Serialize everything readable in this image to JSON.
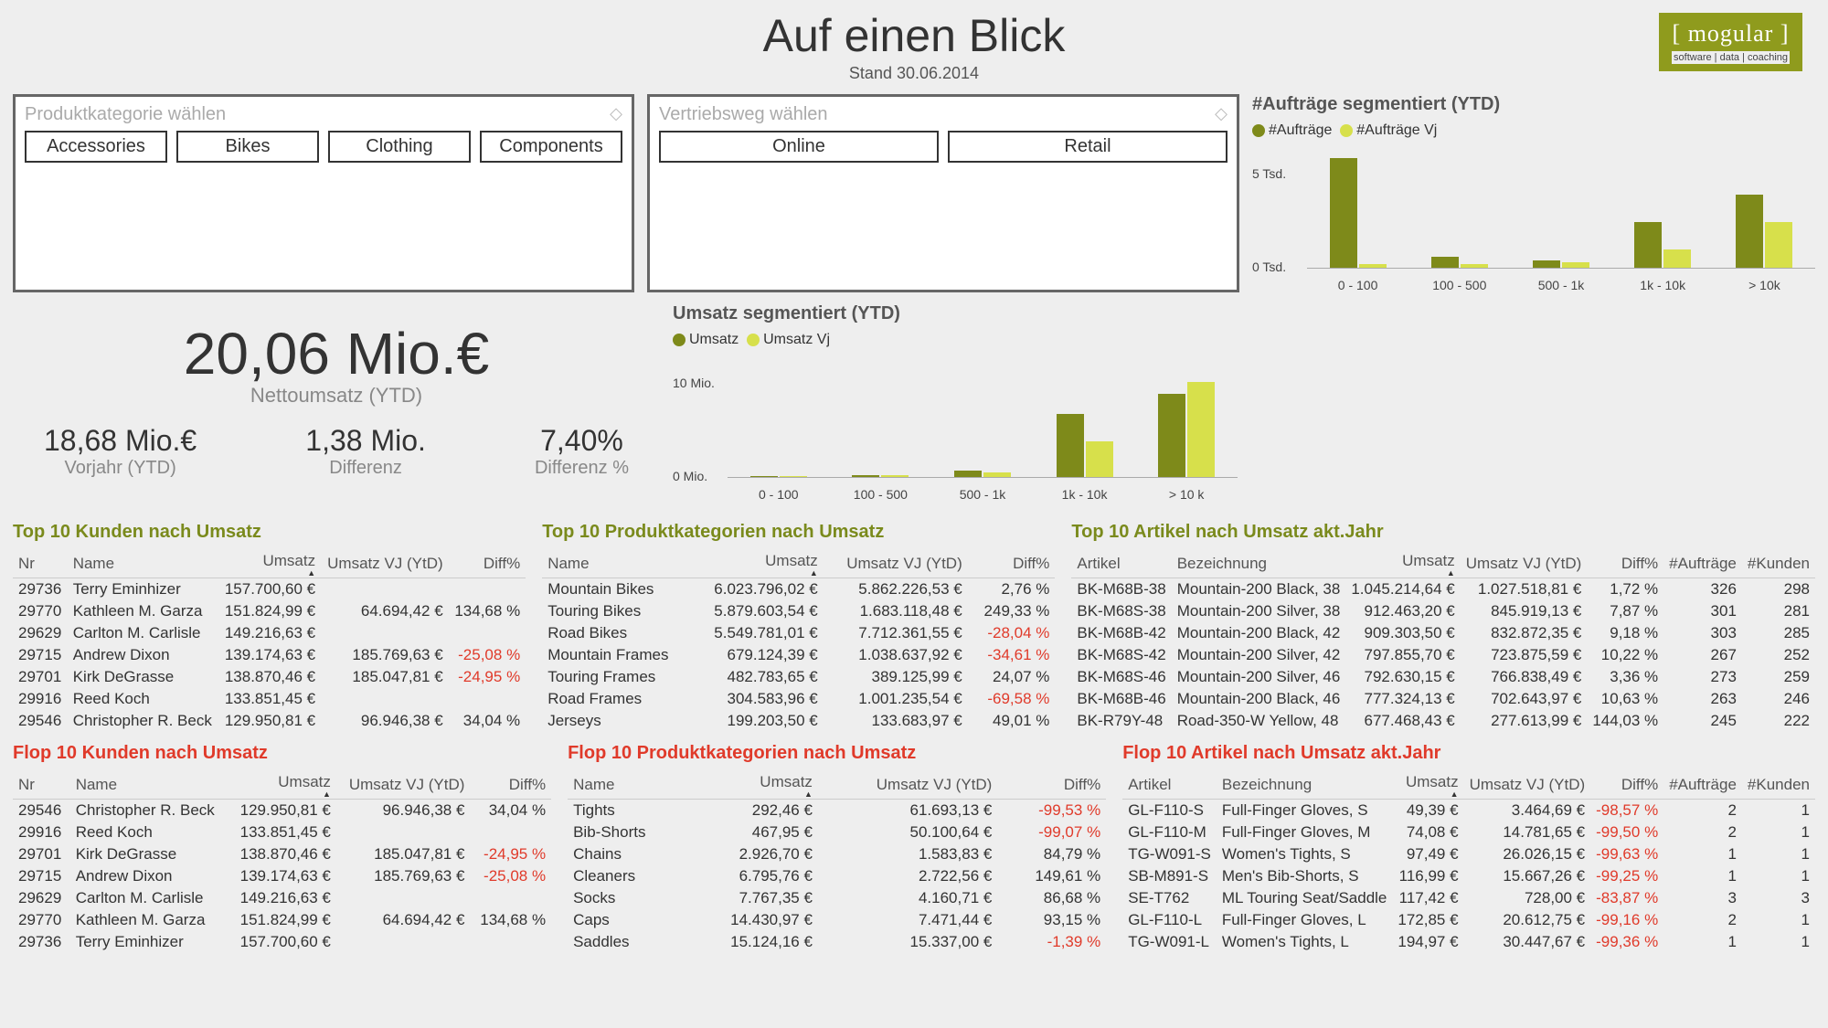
{
  "header": {
    "title": "Auf einen Blick",
    "subtitle": "Stand 30.06.2014"
  },
  "logo": {
    "name": "[ mogular ]",
    "tag": "software | data | coaching"
  },
  "filters": {
    "cat": {
      "label": "Produktkategorie wählen",
      "options": [
        "Accessories",
        "Bikes",
        "Clothing",
        "Components"
      ]
    },
    "channel": {
      "label": "Vertriebsweg wählen",
      "options": [
        "Online",
        "Retail"
      ]
    }
  },
  "kpi": {
    "net": "20,06 Mio.€",
    "netLabel": "Nettoumsatz (YTD)",
    "prev": "18,68 Mio.€",
    "prevLabel": "Vorjahr (YTD)",
    "diff": "1,38 Mio.",
    "diffLabel": "Differenz",
    "diffPct": "7,40%",
    "diffPctLabel": "Differenz %"
  },
  "chart_data": [
    {
      "id": "umsatz",
      "type": "bar",
      "title": "Umsatz segmentiert (YTD)",
      "legend": [
        "Umsatz",
        "Umsatz Vj"
      ],
      "categories": [
        "0 - 100",
        "100 - 500",
        "500 - 1k",
        "1k - 10k",
        "> 10 k"
      ],
      "ylabels": [
        "0 Mio.",
        "10 Mio."
      ],
      "ylim": [
        0,
        15
      ],
      "series": [
        {
          "name": "Umsatz",
          "values": [
            0.1,
            0.2,
            0.8,
            8.0,
            10.5
          ]
        },
        {
          "name": "Umsatz Vj",
          "values": [
            0.1,
            0.2,
            0.6,
            4.5,
            12.0
          ]
        }
      ]
    },
    {
      "id": "auftraege",
      "type": "bar",
      "title": "#Aufträge segmentiert (YTD)",
      "legend": [
        "#Aufträge",
        "#Aufträge Vj"
      ],
      "categories": [
        "0 - 100",
        "100 - 500",
        "500 - 1k",
        "1k - 10k",
        "> 10k"
      ],
      "ylabels": [
        "0 Tsd.",
        "5 Tsd."
      ],
      "ylim": [
        0,
        6.5
      ],
      "series": [
        {
          "name": "#Aufträge",
          "values": [
            6.0,
            0.6,
            0.4,
            2.5,
            4.0
          ]
        },
        {
          "name": "#Aufträge Vj",
          "values": [
            0.2,
            0.2,
            0.3,
            1.0,
            2.5
          ]
        }
      ]
    }
  ],
  "tables": {
    "topKunden": {
      "title": "Top 10 Kunden nach Umsatz",
      "headers": [
        "Nr",
        "Name",
        "Umsatz",
        "Umsatz VJ (YtD)",
        "Diff%"
      ],
      "rows": [
        [
          "29736",
          "Terry Eminhizer",
          "157.700,60 €",
          "",
          ""
        ],
        [
          "29770",
          "Kathleen M. Garza",
          "151.824,99 €",
          "64.694,42 €",
          "134,68 %"
        ],
        [
          "29629",
          "Carlton M. Carlisle",
          "149.216,63 €",
          "",
          ""
        ],
        [
          "29715",
          "Andrew Dixon",
          "139.174,63 €",
          "185.769,63 €",
          "-25,08 %"
        ],
        [
          "29701",
          "Kirk DeGrasse",
          "138.870,46 €",
          "185.047,81 €",
          "-24,95 %"
        ],
        [
          "29916",
          "Reed Koch",
          "133.851,45 €",
          "",
          ""
        ],
        [
          "29546",
          "Christopher R. Beck",
          "129.950,81 €",
          "96.946,38 €",
          "34,04 %"
        ]
      ]
    },
    "flopKunden": {
      "title": "Flop 10 Kunden nach Umsatz",
      "headers": [
        "Nr",
        "Name",
        "Umsatz",
        "Umsatz VJ (YtD)",
        "Diff%"
      ],
      "rows": [
        [
          "29546",
          "Christopher R. Beck",
          "129.950,81 €",
          "96.946,38 €",
          "34,04 %"
        ],
        [
          "29916",
          "Reed Koch",
          "133.851,45 €",
          "",
          ""
        ],
        [
          "29701",
          "Kirk DeGrasse",
          "138.870,46 €",
          "185.047,81 €",
          "-24,95 %"
        ],
        [
          "29715",
          "Andrew Dixon",
          "139.174,63 €",
          "185.769,63 €",
          "-25,08 %"
        ],
        [
          "29629",
          "Carlton M. Carlisle",
          "149.216,63 €",
          "",
          ""
        ],
        [
          "29770",
          "Kathleen M. Garza",
          "151.824,99 €",
          "64.694,42 €",
          "134,68 %"
        ],
        [
          "29736",
          "Terry Eminhizer",
          "157.700,60 €",
          "",
          ""
        ]
      ]
    },
    "topKat": {
      "title": "Top 10 Produktkategorien nach Umsatz",
      "headers": [
        "Name",
        "Umsatz",
        "Umsatz VJ (YtD)",
        "Diff%"
      ],
      "rows": [
        [
          "Mountain Bikes",
          "6.023.796,02 €",
          "5.862.226,53 €",
          "2,76 %"
        ],
        [
          "Touring Bikes",
          "5.879.603,54 €",
          "1.683.118,48 €",
          "249,33 %"
        ],
        [
          "Road Bikes",
          "5.549.781,01 €",
          "7.712.361,55 €",
          "-28,04 %"
        ],
        [
          "Mountain Frames",
          "679.124,39 €",
          "1.038.637,92 €",
          "-34,61 %"
        ],
        [
          "Touring Frames",
          "482.783,65 €",
          "389.125,99 €",
          "24,07 %"
        ],
        [
          "Road Frames",
          "304.583,96 €",
          "1.001.235,54 €",
          "-69,58 %"
        ],
        [
          "Jerseys",
          "199.203,50 €",
          "133.683,97 €",
          "49,01 %"
        ]
      ]
    },
    "flopKat": {
      "title": "Flop 10 Produktkategorien nach Umsatz",
      "headers": [
        "Name",
        "Umsatz",
        "Umsatz VJ (YtD)",
        "Diff%"
      ],
      "rows": [
        [
          "Tights",
          "292,46 €",
          "61.693,13 €",
          "-99,53 %"
        ],
        [
          "Bib-Shorts",
          "467,95 €",
          "50.100,64 €",
          "-99,07 %"
        ],
        [
          "Chains",
          "2.926,70 €",
          "1.583,83 €",
          "84,79 %"
        ],
        [
          "Cleaners",
          "6.795,76 €",
          "2.722,56 €",
          "149,61 %"
        ],
        [
          "Socks",
          "7.767,35 €",
          "4.160,71 €",
          "86,68 %"
        ],
        [
          "Caps",
          "14.430,97 €",
          "7.471,44 €",
          "93,15 %"
        ],
        [
          "Saddles",
          "15.124,16 €",
          "15.337,00 €",
          "-1,39 %"
        ]
      ]
    },
    "topArt": {
      "title": "Top 10 Artikel nach Umsatz akt.Jahr",
      "headers": [
        "Artikel",
        "Bezeichnung",
        "Umsatz",
        "Umsatz VJ (YtD)",
        "Diff%",
        "#Aufträge",
        "#Kunden"
      ],
      "rows": [
        [
          "BK-M68B-38",
          "Mountain-200 Black, 38",
          "1.045.214,64 €",
          "1.027.518,81 €",
          "1,72 %",
          "326",
          "298"
        ],
        [
          "BK-M68S-38",
          "Mountain-200 Silver, 38",
          "912.463,20 €",
          "845.919,13 €",
          "7,87 %",
          "301",
          "281"
        ],
        [
          "BK-M68B-42",
          "Mountain-200 Black, 42",
          "909.303,50 €",
          "832.872,35 €",
          "9,18 %",
          "303",
          "285"
        ],
        [
          "BK-M68S-42",
          "Mountain-200 Silver, 42",
          "797.855,70 €",
          "723.875,59 €",
          "10,22 %",
          "267",
          "252"
        ],
        [
          "BK-M68S-46",
          "Mountain-200 Silver, 46",
          "792.630,15 €",
          "766.838,49 €",
          "3,36 %",
          "273",
          "259"
        ],
        [
          "BK-M68B-46",
          "Mountain-200 Black, 46",
          "777.324,13 €",
          "702.643,97 €",
          "10,63 %",
          "263",
          "246"
        ],
        [
          "BK-R79Y-48",
          "Road-350-W Yellow, 48",
          "677.468,43 €",
          "277.613,99 €",
          "144,03 %",
          "245",
          "222"
        ]
      ]
    },
    "flopArt": {
      "title": "Flop 10 Artikel nach Umsatz akt.Jahr",
      "headers": [
        "Artikel",
        "Bezeichnung",
        "Umsatz",
        "Umsatz VJ (YtD)",
        "Diff%",
        "#Aufträge",
        "#Kunden"
      ],
      "rows": [
        [
          "GL-F110-S",
          "Full-Finger Gloves, S",
          "49,39 €",
          "3.464,69 €",
          "-98,57 %",
          "2",
          "1"
        ],
        [
          "GL-F110-M",
          "Full-Finger Gloves, M",
          "74,08 €",
          "14.781,65 €",
          "-99,50 %",
          "2",
          "1"
        ],
        [
          "TG-W091-S",
          "Women's Tights, S",
          "97,49 €",
          "26.026,15 €",
          "-99,63 %",
          "1",
          "1"
        ],
        [
          "SB-M891-S",
          "Men's Bib-Shorts, S",
          "116,99 €",
          "15.667,26 €",
          "-99,25 %",
          "1",
          "1"
        ],
        [
          "SE-T762",
          "ML Touring Seat/Saddle",
          "117,42 €",
          "728,00 €",
          "-83,87 %",
          "3",
          "3"
        ],
        [
          "GL-F110-L",
          "Full-Finger Gloves, L",
          "172,85 €",
          "20.612,75 €",
          "-99,16 %",
          "2",
          "1"
        ],
        [
          "TG-W091-L",
          "Women's Tights, L",
          "194,97 €",
          "30.447,67 €",
          "-99,36 %",
          "1",
          "1"
        ]
      ]
    }
  }
}
